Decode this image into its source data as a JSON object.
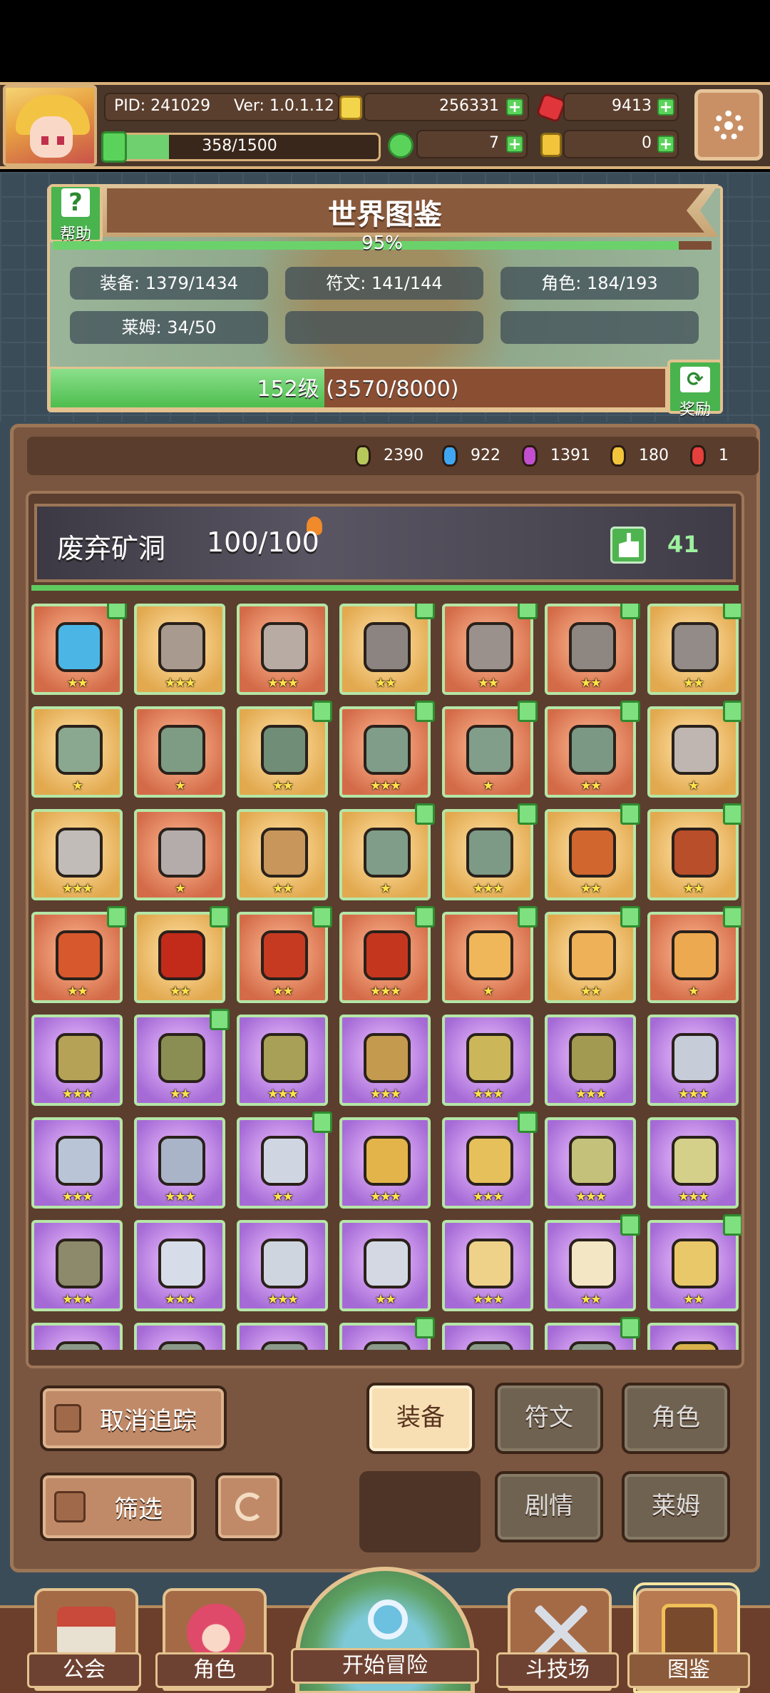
{
  "header": {
    "pid": "PID: 241029",
    "ver": "Ver: 1.0.1.12",
    "gold": "256331",
    "ruby": "9413",
    "stamina": "358/1500",
    "clover": "7",
    "keys": "0"
  },
  "codex": {
    "title": "世界图鉴",
    "help_label": "帮助",
    "percent": "95%",
    "stats": [
      "装备: 1379/1434",
      "符文: 141/144",
      "角色: 184/193",
      "莱姆: 34/50"
    ],
    "level_text": "152级 (3570/8000)",
    "level_progress": 0.446,
    "reward_label": "奖励"
  },
  "gems": [
    "2390",
    "922",
    "1391",
    "180",
    "1"
  ],
  "gem_colors": [
    "#b7c85b",
    "#3fa7f2",
    "#c24fcf",
    "#f2c43b",
    "#e5403d"
  ],
  "area": {
    "name": "废弃矿洞",
    "count": "100/100",
    "likes": "41"
  },
  "grid": {
    "rows": [
      [
        {
          "r": "red",
          "s": 2,
          "l": true,
          "c": "#4bb6e6"
        },
        {
          "r": "gold",
          "s": 3,
          "l": false,
          "c": "#a89a8e"
        },
        {
          "r": "red",
          "s": 3,
          "l": false,
          "c": "#b7aba3"
        },
        {
          "r": "gold",
          "s": 2,
          "l": true,
          "c": "#8c8480"
        },
        {
          "r": "red",
          "s": 2,
          "l": true,
          "c": "#9a908c"
        },
        {
          "r": "red",
          "s": 2,
          "l": true,
          "c": "#8e8680"
        },
        {
          "r": "gold",
          "s": 2,
          "l": true,
          "c": "#938b88"
        }
      ],
      [
        {
          "r": "gold",
          "s": 1,
          "l": false,
          "c": "#8aa88f"
        },
        {
          "r": "red",
          "s": 1,
          "l": false,
          "c": "#7e9b84"
        },
        {
          "r": "gold",
          "s": 2,
          "l": true,
          "c": "#6f8d77"
        },
        {
          "r": "red",
          "s": 3,
          "l": true,
          "c": "#7f9d88"
        },
        {
          "r": "red",
          "s": 1,
          "l": true,
          "c": "#819e8a"
        },
        {
          "r": "red",
          "s": 2,
          "l": true,
          "c": "#7a9883"
        },
        {
          "r": "gold",
          "s": 1,
          "l": true,
          "c": "#bfb6b2"
        }
      ],
      [
        {
          "r": "gold",
          "s": 3,
          "l": false,
          "c": "#c2bcb8"
        },
        {
          "r": "red",
          "s": 1,
          "l": false,
          "c": "#b4acaa"
        },
        {
          "r": "gold",
          "s": 2,
          "l": false,
          "c": "#c8965a"
        },
        {
          "r": "gold",
          "s": 1,
          "l": true,
          "c": "#7f9d88"
        },
        {
          "r": "gold",
          "s": 3,
          "l": true,
          "c": "#7c9a86"
        },
        {
          "r": "gold",
          "s": 2,
          "l": true,
          "c": "#d2662f"
        },
        {
          "r": "gold",
          "s": 2,
          "l": true,
          "c": "#b94e2a"
        }
      ],
      [
        {
          "r": "red",
          "s": 2,
          "l": true,
          "c": "#d7582c"
        },
        {
          "r": "gold",
          "s": 2,
          "l": true,
          "c": "#c22a1a"
        },
        {
          "r": "red",
          "s": 2,
          "l": true,
          "c": "#c63a22"
        },
        {
          "r": "red",
          "s": 3,
          "l": true,
          "c": "#c5361f"
        },
        {
          "r": "red",
          "s": 1,
          "l": true,
          "c": "#f0b75a"
        },
        {
          "r": "gold",
          "s": 2,
          "l": true,
          "c": "#eeb158"
        },
        {
          "r": "red",
          "s": 1,
          "l": true,
          "c": "#eca94f"
        }
      ],
      [
        {
          "r": "purple",
          "s": 3,
          "l": false,
          "c": "#b6a257"
        },
        {
          "r": "purple",
          "s": 2,
          "l": true,
          "c": "#8a8e52"
        },
        {
          "r": "purple",
          "s": 3,
          "l": false,
          "c": "#a7a056"
        },
        {
          "r": "purple",
          "s": 3,
          "l": false,
          "c": "#c49a4e"
        },
        {
          "r": "purple",
          "s": 3,
          "l": false,
          "c": "#cbb75a"
        },
        {
          "r": "purple",
          "s": 3,
          "l": false,
          "c": "#a39a52"
        },
        {
          "r": "purple",
          "s": 3,
          "l": false,
          "c": "#c6ccd8"
        }
      ],
      [
        {
          "r": "purple",
          "s": 3,
          "l": false,
          "c": "#b9c4d6"
        },
        {
          "r": "purple",
          "s": 3,
          "l": false,
          "c": "#a9b4c8"
        },
        {
          "r": "purple",
          "s": 2,
          "l": true,
          "c": "#cfd6e2"
        },
        {
          "r": "purple",
          "s": 3,
          "l": false,
          "c": "#e2b44a"
        },
        {
          "r": "purple",
          "s": 3,
          "l": true,
          "c": "#e6c05a"
        },
        {
          "r": "purple",
          "s": 3,
          "l": false,
          "c": "#c4c27a"
        },
        {
          "r": "purple",
          "s": 3,
          "l": false,
          "c": "#d4d08a"
        }
      ],
      [
        {
          "r": "purple",
          "s": 3,
          "l": false,
          "c": "#8c8a6a"
        },
        {
          "r": "purple",
          "s": 3,
          "l": false,
          "c": "#d6dde8"
        },
        {
          "r": "purple",
          "s": 3,
          "l": false,
          "c": "#cfd5df"
        },
        {
          "r": "purple",
          "s": 2,
          "l": false,
          "c": "#d3d8e2"
        },
        {
          "r": "purple",
          "s": 3,
          "l": false,
          "c": "#efd28a"
        },
        {
          "r": "purple",
          "s": 2,
          "l": true,
          "c": "#f2e6c4"
        },
        {
          "r": "purple",
          "s": 2,
          "l": true,
          "c": "#e9c86a"
        }
      ],
      [
        {
          "r": "purple",
          "s": 0,
          "l": false,
          "c": "#8c9a8a"
        },
        {
          "r": "purple",
          "s": 0,
          "l": false,
          "c": "#8c9a8a"
        },
        {
          "r": "purple",
          "s": 0,
          "l": false,
          "c": "#8c9a8a"
        },
        {
          "r": "purple",
          "s": 0,
          "l": true,
          "c": "#8c9a8a"
        },
        {
          "r": "purple",
          "s": 0,
          "l": false,
          "c": "#8c9a8a"
        },
        {
          "r": "purple",
          "s": 0,
          "l": true,
          "c": "#8c9a8a"
        },
        {
          "r": "purple",
          "s": 0,
          "l": false,
          "c": "#d8b24a"
        }
      ]
    ]
  },
  "controls": {
    "untrack": "取消追踪",
    "filter": "筛选",
    "tab_equipment": "装备",
    "tab_rune": "符文",
    "tab_character": "角色",
    "tab_story": "剧情",
    "tab_slime": "莱姆"
  },
  "nav": {
    "guild": "公会",
    "character": "角色",
    "adventure": "开始冒险",
    "arena": "斗技场",
    "codex": "图鉴"
  }
}
